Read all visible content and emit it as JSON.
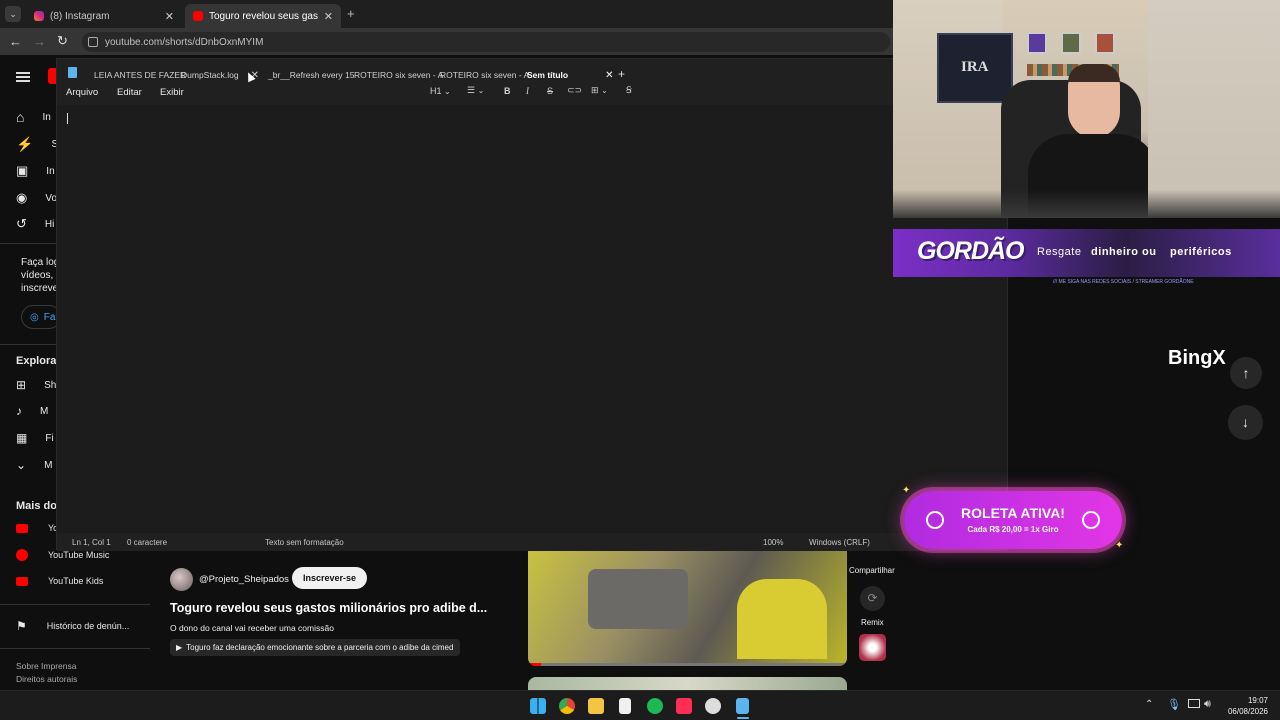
{
  "browser": {
    "tabs": [
      {
        "label": "(8) Instagram",
        "color": "#e1306c"
      },
      {
        "label": "Toguro revelou seus gastos mili…",
        "color": "#ff0000"
      }
    ],
    "url": "youtube.com/shorts/dDnbOxnMYIM"
  },
  "youtube": {
    "nav_main": [
      "In",
      "Sh",
      "In",
      "Vo",
      "Hi"
    ],
    "login_prompt": [
      "Faça log",
      "vídeos, c",
      "inscreve"
    ],
    "login_button": "Fa",
    "explore_title": "Explorar",
    "explore_items": [
      "Sh",
      "M",
      "Fi",
      "M"
    ],
    "more_title": "Mais do",
    "more_items": [
      "Yo",
      "YouTube Music",
      "YouTube Kids"
    ],
    "report_history": "Histórico de denún...",
    "footer": [
      "Sobre  Imprensa",
      "Direitos autorais"
    ],
    "channel": "@Projeto_Sheipados",
    "subscribe": "Inscrever-se",
    "video_title": "Toguro revelou seus gastos milionários pro adibe d...",
    "video_subtitle": "O dono do canal vai receber uma comissão",
    "related": "Toguro faz declaração emocionante sobre a parceria com o adibe da cimed",
    "share": "Compartilhar",
    "remix": "Remix"
  },
  "notepad": {
    "tabs": [
      {
        "label": "LEIA ANTES DE FAZER"
      },
      {
        "label": "DumpStack.log"
      },
      {
        "label": "_br__Refresh every 15"
      },
      {
        "label": "ROTEIRO six seven - A"
      },
      {
        "label": "ROTEIRO six seven - A"
      },
      {
        "label": "Sem título",
        "active": true
      }
    ],
    "menu": [
      "Arquivo",
      "Editar",
      "Exibir"
    ],
    "heading": "H1",
    "status": {
      "position": "Ln 1, Col 1",
      "chars": "0 caractere",
      "format": "Texto sem formatação",
      "zoom": "100%",
      "eol": "Windows (CRLF)"
    }
  },
  "overlay": {
    "banner_logo": "GORDÃO",
    "banner_text_1": "Resgate",
    "banner_text_2": "dinheiro ou",
    "banner_text_3": "periféricos",
    "banner_sub": "/// ME SIGA NAS REDES SOCIAIS / STREAMER GORDÃONE",
    "sponsor": "BingX",
    "roleta_title": "ROLETA ATIVA!",
    "roleta_sub": "Cada R$ 20,00 = 1x Giro",
    "shirt_logo": "IRA"
  },
  "taskbar": {
    "time": "19:07",
    "date": "06/08/2026"
  }
}
